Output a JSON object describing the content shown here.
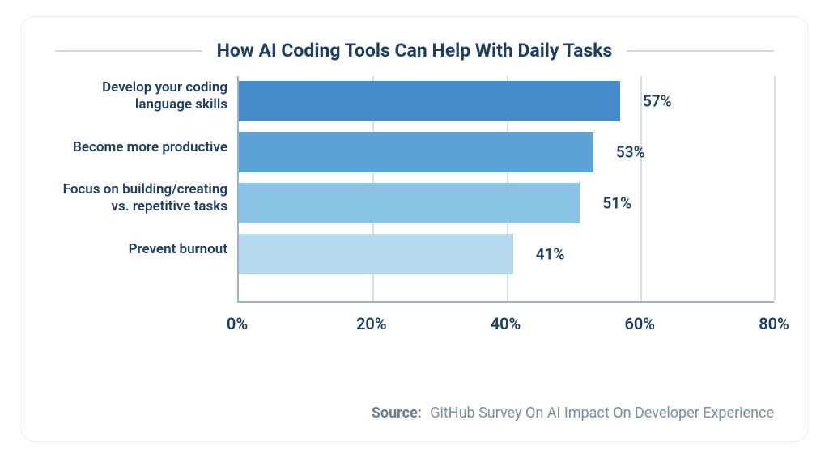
{
  "chart_data": {
    "type": "bar",
    "orientation": "horizontal",
    "title": "How AI Coding Tools Can Help With Daily Tasks",
    "categories": [
      "Develop your coding language skills",
      "Become more productive",
      "Focus on building/creating vs. repetitive tasks",
      "Prevent burnout"
    ],
    "values": [
      57,
      53,
      51,
      41
    ],
    "value_labels": [
      "57%",
      "53%",
      "51%",
      "41%"
    ],
    "xlim": [
      0,
      80
    ],
    "xticks": [
      0,
      20,
      40,
      60,
      80
    ],
    "xtick_labels": [
      "0%",
      "20%",
      "40%",
      "60%",
      "80%"
    ],
    "bar_colors": [
      "#468cca",
      "#5ba3d7",
      "#88c3e6",
      "#b5daf0"
    ],
    "grid_x": [
      20,
      40,
      60,
      80
    ]
  },
  "source": {
    "label": "Source:",
    "text": "GitHub Survey On AI Impact On Developer Experience"
  }
}
